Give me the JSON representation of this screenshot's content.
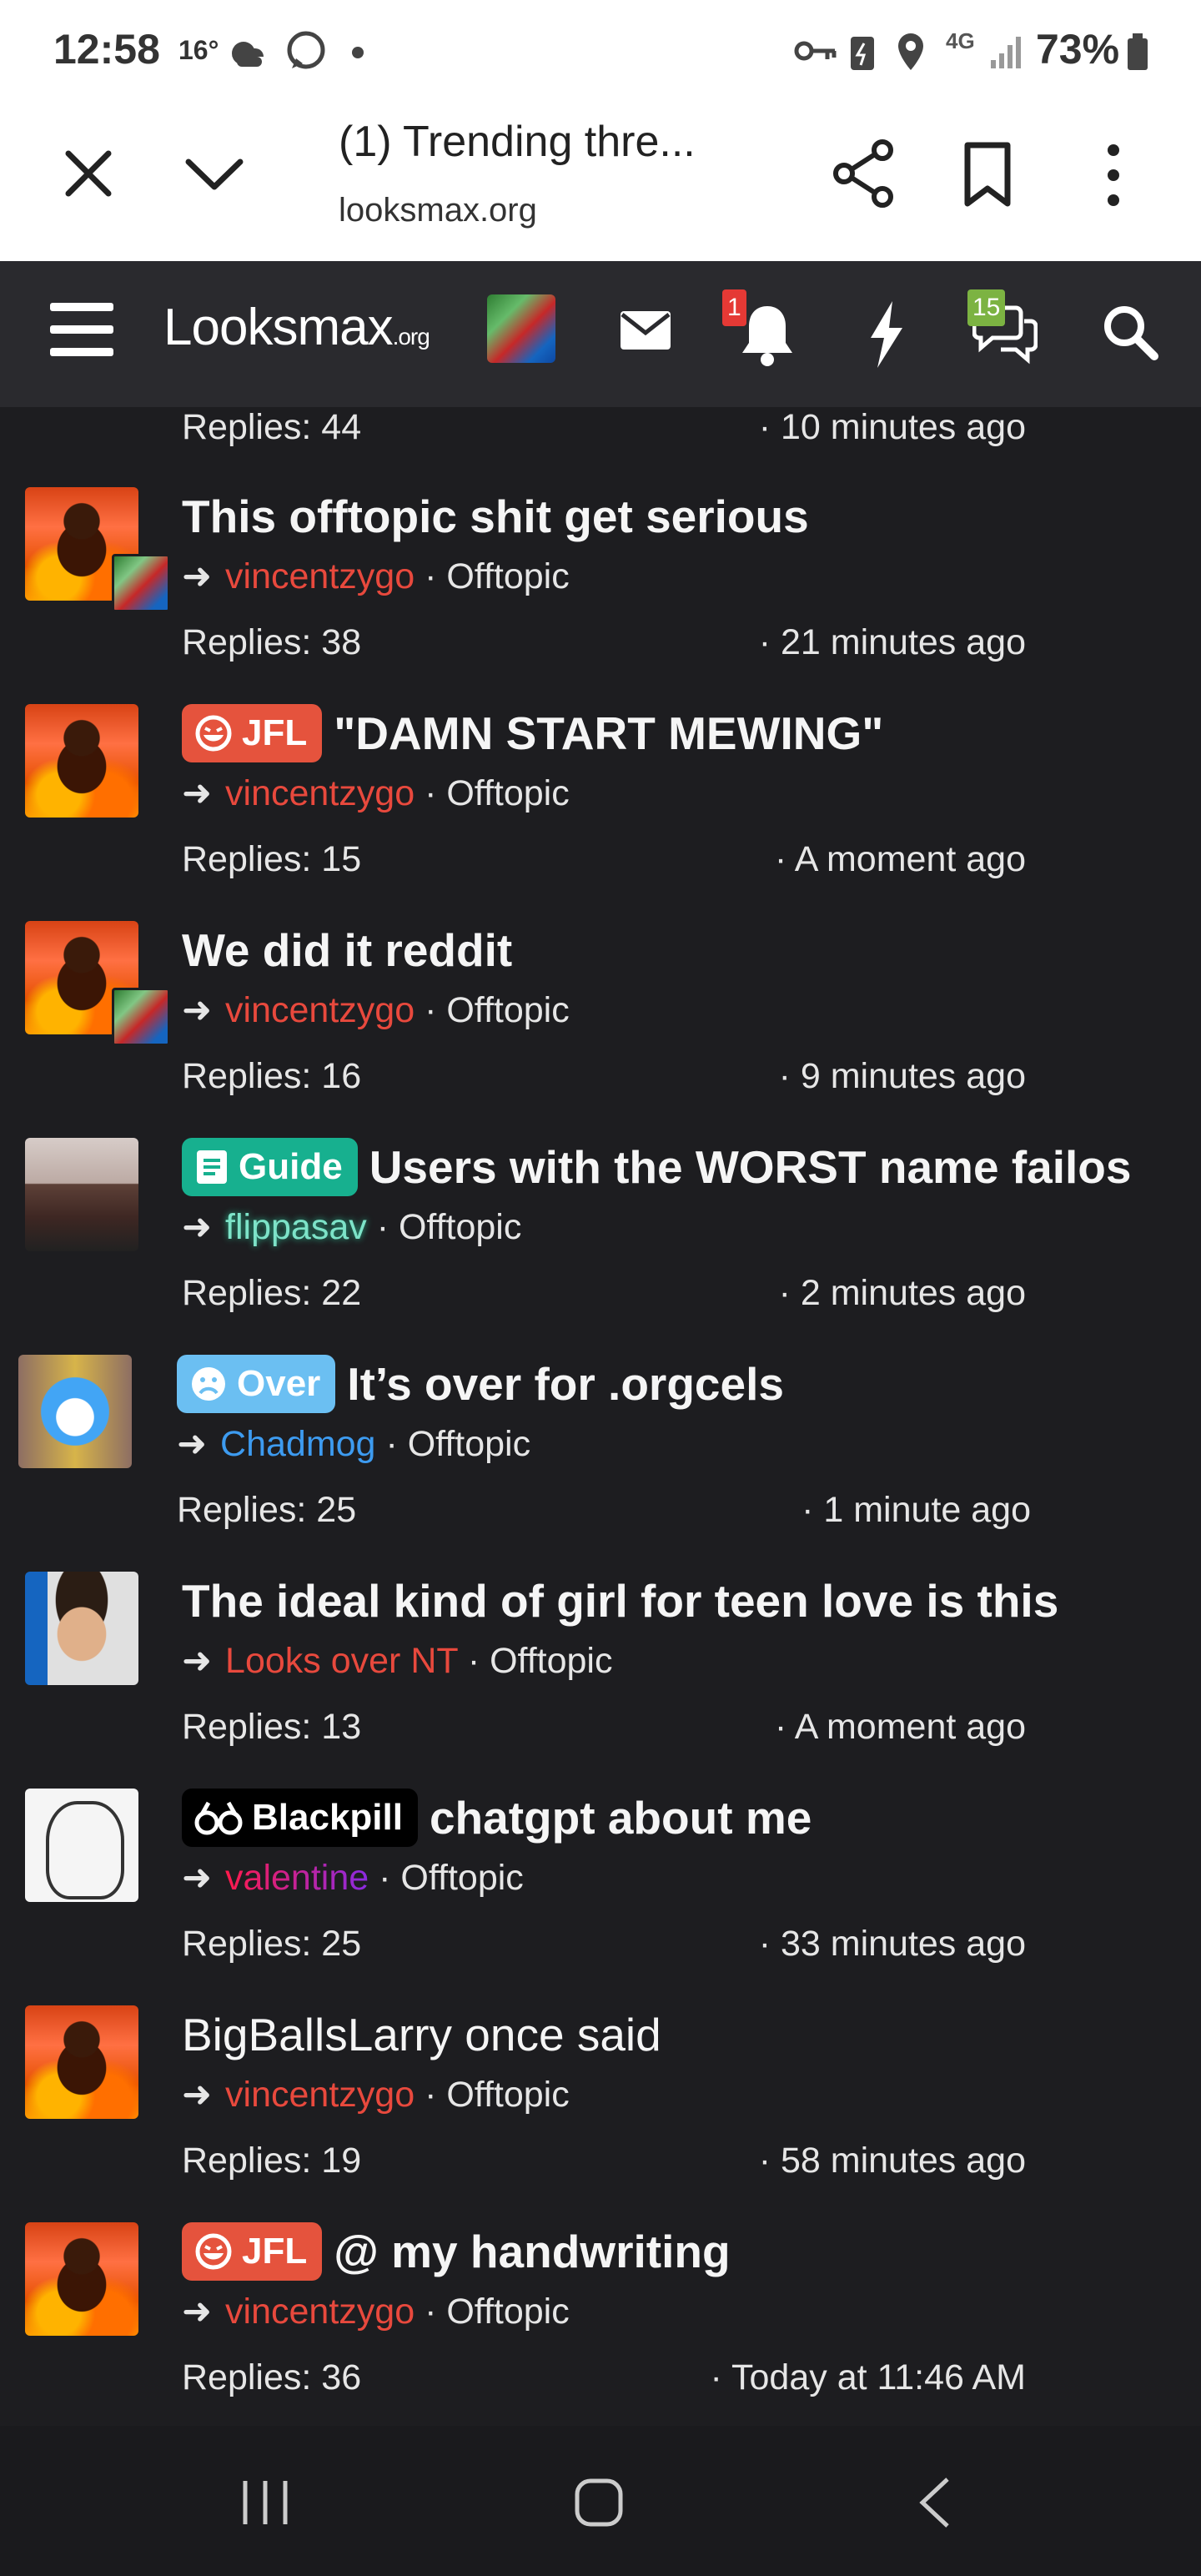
{
  "status_bar": {
    "time": "12:58",
    "temperature": "16°",
    "network": "4G",
    "battery": "73%"
  },
  "browser": {
    "tab_title": "(1) Trending thre...",
    "url": "looksmax.org"
  },
  "site_header": {
    "logo_text": "Looksmax",
    "logo_suffix": ".org",
    "notifications_badge": "1",
    "conversations_badge": "15"
  },
  "threads": [
    {
      "title": "",
      "prefix": "",
      "author": "",
      "forum": "",
      "replies": "Replies: 44",
      "time": "· 10 minutes ago"
    },
    {
      "title": "This offtopic shit get serious",
      "prefix": "",
      "author": "vincentzygo",
      "forum": "· Offtopic",
      "replies": "Replies: 38",
      "time": "· 21 minutes ago"
    },
    {
      "title": "\"DAMN START MEWING\"",
      "prefix": "JFL",
      "author": "vincentzygo",
      "forum": "· Offtopic",
      "replies": "Replies: 15",
      "time": "· A moment ago"
    },
    {
      "title": "We did it reddit",
      "prefix": "",
      "author": "vincentzygo",
      "forum": "· Offtopic",
      "replies": "Replies: 16",
      "time": "· 9 minutes ago"
    },
    {
      "title": "Users with the WORST name failos",
      "prefix": "Guide",
      "author": "flippasav",
      "forum": "· Offtopic",
      "replies": "Replies: 22",
      "time": "· 2 minutes ago"
    },
    {
      "title": "It’s over for .orgcels",
      "prefix": "Over",
      "author": "Chadmog",
      "forum": "· Offtopic",
      "replies": "Replies: 25",
      "time": "· 1 minute ago"
    },
    {
      "title": "The ideal kind of girl for teen love is this",
      "prefix": "",
      "author": "Looks over NT",
      "forum": "· Offtopic",
      "replies": "Replies: 13",
      "time": "· A moment ago"
    },
    {
      "title": "chatgpt about me",
      "prefix": "Blackpill",
      "author": "valentine",
      "forum": "· Offtopic",
      "replies": "Replies: 25",
      "time": "· 33 minutes ago"
    },
    {
      "title": "BigBallsLarry once said",
      "prefix": "",
      "author": "vincentzygo",
      "forum": "· Offtopic",
      "replies": "Replies: 19",
      "time": "· 58 minutes ago"
    },
    {
      "title": "@ my handwriting",
      "prefix": "JFL",
      "author": "vincentzygo",
      "forum": "· Offtopic",
      "replies": "Replies: 36",
      "time": "· Today at 11:46 AM"
    }
  ],
  "colors": {
    "background": "#1d1d20",
    "header": "#2a2a2e",
    "jfl_prefix": "#e5533d",
    "guide_prefix": "#17b08f",
    "over_prefix": "#6bbff2",
    "blackpill_prefix": "#000000",
    "username_red": "#e8493d",
    "username_blue": "#3d9bf0"
  }
}
